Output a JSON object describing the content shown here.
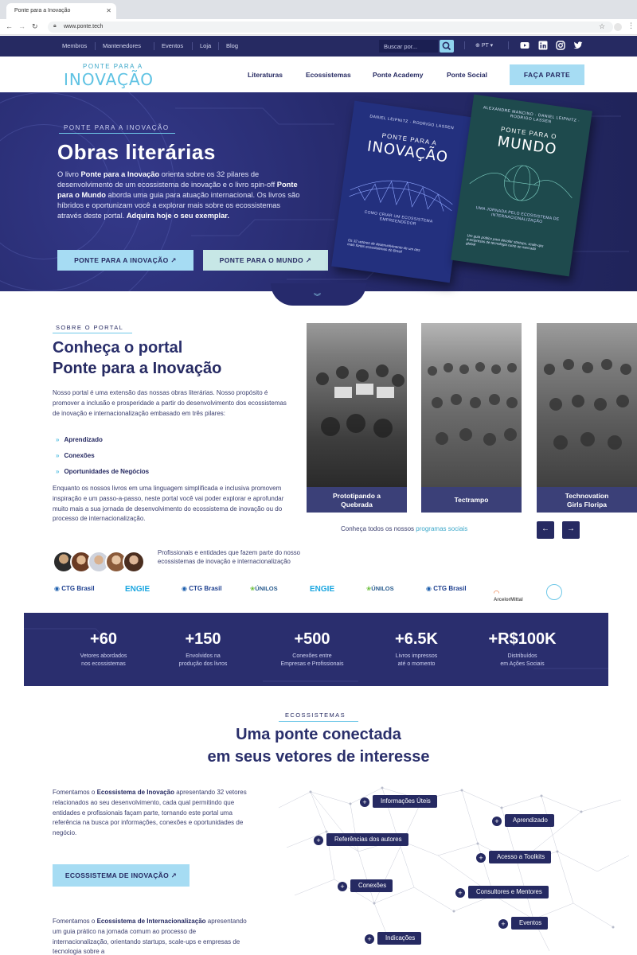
{
  "browser": {
    "tab_title": "Ponte para a Inovação",
    "url": "www.ponte.tech"
  },
  "topnav": {
    "links": [
      "Membros",
      "Mantenedores",
      "Eventos",
      "Loja",
      "Blog"
    ],
    "search_placeholder": "Buscar por...",
    "language": "PT",
    "social_icons": [
      "youtube-icon",
      "linkedin-icon",
      "instagram-icon",
      "twitter-icon"
    ]
  },
  "header": {
    "logo_top": "PONTE PARA A",
    "logo_main": "INOVAÇÃO",
    "nav": [
      "Literaturas",
      "Ecossistemas",
      "Ponte Academy",
      "Ponte Social"
    ],
    "cta": "FAÇA PARTE"
  },
  "hero": {
    "kicker": "PONTE PARA A INOVAÇÃO",
    "title": "Obras literárias",
    "text_1": "O livro ",
    "text_bold_1": "Ponte para a Inovação",
    "text_2": " orienta sobre os 32 pilares de desenvolvimento de um ecossistema de inovação e o livro spin-off ",
    "text_bold_2": "Ponte para o Mundo",
    "text_3": " aborda uma guia para atuação internacional. Os livros são híbridos e oportunizam você a explorar mais sobre os ecossistemas através deste portal. ",
    "text_bold_3": "Adquira hoje o seu exemplar.",
    "button_1": "PONTE PARA A INOVAÇÃO ↗",
    "button_2": "PONTE PARA O MUNDO ↗",
    "book_1": {
      "authors": "DANIEL LEIPNITZ · RODRIGO LASSEN",
      "small": "PONTE PARA A",
      "big": "INOVAÇÃO",
      "subtitle": "COMO CRIAR UM ECOSSISTEMA EMPREENDEDOR",
      "foot": "Os 32 vetores de desenvolvimento de um dos mais fortes ecossistemas do Brasil"
    },
    "book_2": {
      "authors": "ALEXANDRE MANCINO · DANIEL LEIPNITZ · RODRIGO LASSEN",
      "small": "PONTE PARA O",
      "big": "MUNDO",
      "subtitle": "UMA JORNADA PELO ECOSSISTEMA DE INTERNACIONALIZAÇÃO",
      "foot": "Um guia prático para decolar startups, scale-ups e empresas de tecnologia rumo ao mercado global"
    }
  },
  "about": {
    "kicker": "SOBRE O PORTAL",
    "title_1": "Conheça o portal",
    "title_2": "Ponte para a Inovação",
    "para_1": "Nosso portal é uma extensão das nossas obras literárias. Nosso propósito é promover a inclusão e prosperidade a partir do desenvolvimento dos ecossistemas de inovação e internacionalização embasado em três pilares:",
    "pillars": [
      "Aprendizado",
      "Conexões",
      "Oportunidades de Negócios"
    ],
    "para_2": "Enquanto os nossos livros em uma linguagem simplificada e inclusiva promovem inspiração e um passo-a-passo, neste portal você vai poder explorar e aprofundar muito mais a sua jornada de desenvolvimento do ecossistema de inovação ou do processo de internacionalização.",
    "avatars_caption": "Profissionais e entidades que fazem parte do nosso ecossistemas de inovação e internacionalização",
    "partners": [
      "CTG Brasil",
      "ENGIE",
      "CTG Brasil",
      "ÚNILOS",
      "ENGIE",
      "ÚNILOS",
      "CTG Brasil",
      "ArcelorMittal"
    ],
    "programs": [
      {
        "label_1": "Prototipando a",
        "label_2": "Quebrada"
      },
      {
        "label_1": "Tectrampo",
        "label_2": ""
      },
      {
        "label_1": "Technovation",
        "label_2": "Girls Floripa"
      }
    ],
    "programs_text": "Conheça todos os nossos ",
    "programs_link": "programas sociais"
  },
  "stats": [
    {
      "value": "+60",
      "label_1": "Vetores abordados",
      "label_2": "nos ecossistemas"
    },
    {
      "value": "+150",
      "label_1": "Envolvidos na",
      "label_2": "produção dos livros"
    },
    {
      "value": "+500",
      "label_1": "Conexões entre",
      "label_2": "Empresas e Profissionais"
    },
    {
      "value": "+6.5K",
      "label_1": "Livros impressos",
      "label_2": "até o momento"
    },
    {
      "value": "+R$100K",
      "label_1": "Distribuídos",
      "label_2": "em Ações Sociais"
    }
  ],
  "eco": {
    "kicker": "ECOSSISTEMAS",
    "title_1": "Uma ponte conectada",
    "title_2": "em seus vetores de interesse",
    "para_1_a": "Fomentamos o ",
    "para_1_b": "Ecossistema de Inovação",
    "para_1_c": " apresentando 32 vetores relacionados ao seu desenvolvimento, cada qual permitindo que entidades e profissionais façam parte, tornando este portal uma referência na busca por informações, conexões e oportunidades de negócio.",
    "button": "ECOSSISTEMA DE INOVAÇÃO ↗",
    "para_2_a": "Fomentamos o ",
    "para_2_b": "Ecossistema de Internacionalização",
    "para_2_c": " apresentando um guia prático na jornada comum ao processo de internacionalização, orientando startups, scale-ups e empresas de tecnologia sobre a",
    "tags": [
      "Informações Úteis",
      "Referências dos autores",
      "Conexões",
      "Indicações",
      "Aprendizado",
      "Acesso a Toolkits",
      "Consultores e Mentores",
      "Eventos"
    ]
  }
}
